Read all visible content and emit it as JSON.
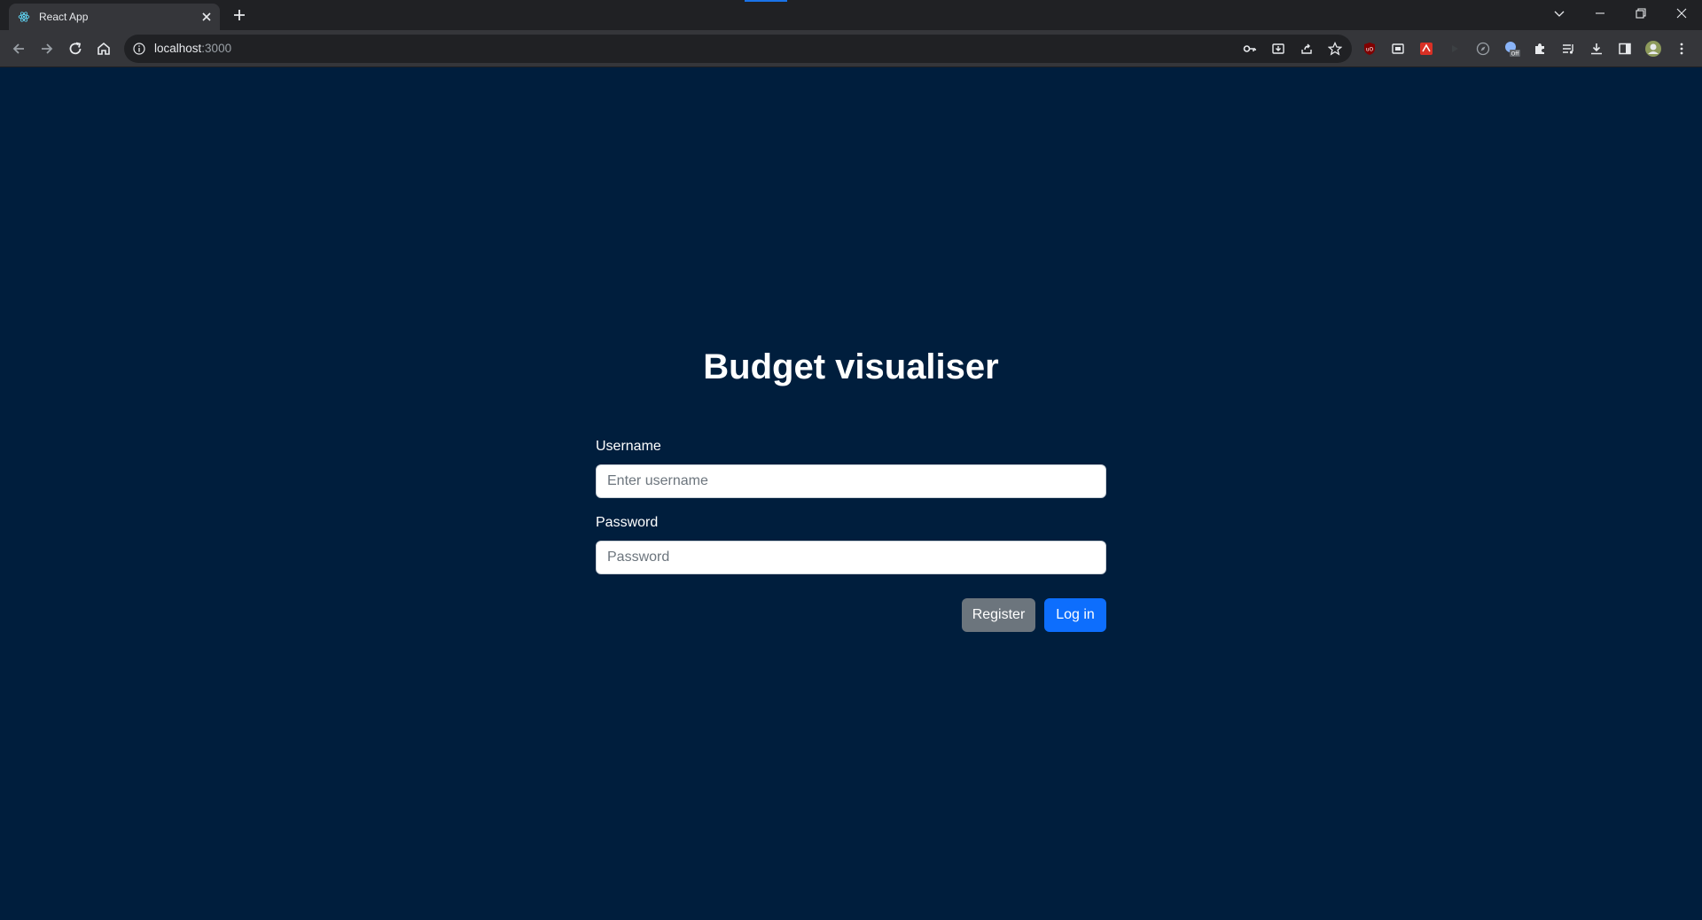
{
  "browser": {
    "tab_title": "React App",
    "url_host": "localhost",
    "url_port": ":3000"
  },
  "icons": {
    "favicon": "react-icon",
    "back": "back-arrow-icon",
    "forward": "forward-arrow-icon",
    "reload": "reload-icon",
    "home": "home-icon"
  },
  "colors": {
    "page_background": "#001e3d",
    "primary": "#0d6efd",
    "secondary": "#6c757d"
  },
  "login": {
    "title": "Budget visualiser",
    "username_label": "Username",
    "username_placeholder": "Enter username",
    "password_label": "Password",
    "password_placeholder": "Password",
    "register_label": "Register",
    "login_label": "Log in"
  }
}
